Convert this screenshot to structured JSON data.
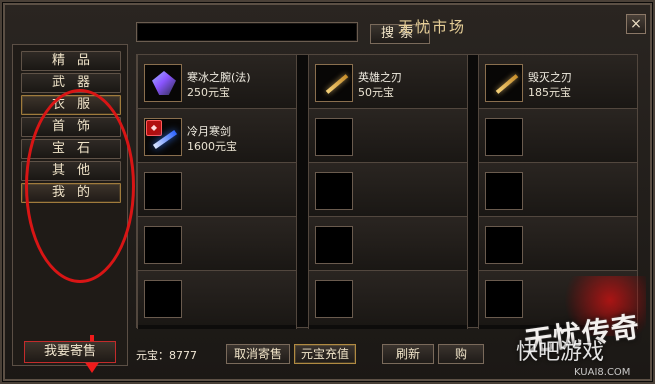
{
  "window": {
    "title": "无忧市场",
    "close_glyph": "×"
  },
  "search": {
    "value": "",
    "button_label": "搜索"
  },
  "sidebar": {
    "items": [
      {
        "label": "精品"
      },
      {
        "label": "武器"
      },
      {
        "label": "衣服",
        "active": true
      },
      {
        "label": "首饰"
      },
      {
        "label": "宝石"
      },
      {
        "label": "其他"
      },
      {
        "label": "我的",
        "active": true
      }
    ],
    "consign_button_label": "我要寄售"
  },
  "grid": {
    "columns": [
      {
        "items": [
          {
            "name": "寒冰之腕(法)",
            "price": "250元宝",
            "icon": "ice-wrist-gem-icon"
          },
          {
            "name": "冷月寒剑",
            "price": "1600元宝",
            "icon": "cold-moon-sword-icon"
          },
          {
            "name": "",
            "price": "",
            "icon": ""
          },
          {
            "name": "",
            "price": "",
            "icon": ""
          },
          {
            "name": "",
            "price": "",
            "icon": ""
          }
        ]
      },
      {
        "items": [
          {
            "name": "英雄之刃",
            "price": "50元宝",
            "icon": "hero-blade-icon"
          },
          {
            "name": "",
            "price": "",
            "icon": ""
          },
          {
            "name": "",
            "price": "",
            "icon": ""
          },
          {
            "name": "",
            "price": "",
            "icon": ""
          },
          {
            "name": "",
            "price": "",
            "icon": ""
          }
        ]
      },
      {
        "items": [
          {
            "name": "毁灭之刃",
            "price": "185元宝",
            "icon": "destruction-blade-icon"
          },
          {
            "name": "",
            "price": "",
            "icon": ""
          },
          {
            "name": "",
            "price": "",
            "icon": ""
          },
          {
            "name": "",
            "price": "",
            "icon": ""
          },
          {
            "name": "",
            "price": "",
            "icon": ""
          }
        ]
      }
    ]
  },
  "bottombar": {
    "currency_label": "元宝：8777",
    "buttons": [
      {
        "label": "取消寄售"
      },
      {
        "label": "元宝充值",
        "active": true
      },
      {
        "label": "刷新"
      },
      {
        "label": "购"
      }
    ]
  },
  "watermark": {
    "game_logo_text": "无忧传奇",
    "site_name": "快吧游戏",
    "site_url": "KUAI8.COM"
  },
  "colors": {
    "accent_gold": "#b08a42",
    "highlight_red": "#d81515"
  }
}
